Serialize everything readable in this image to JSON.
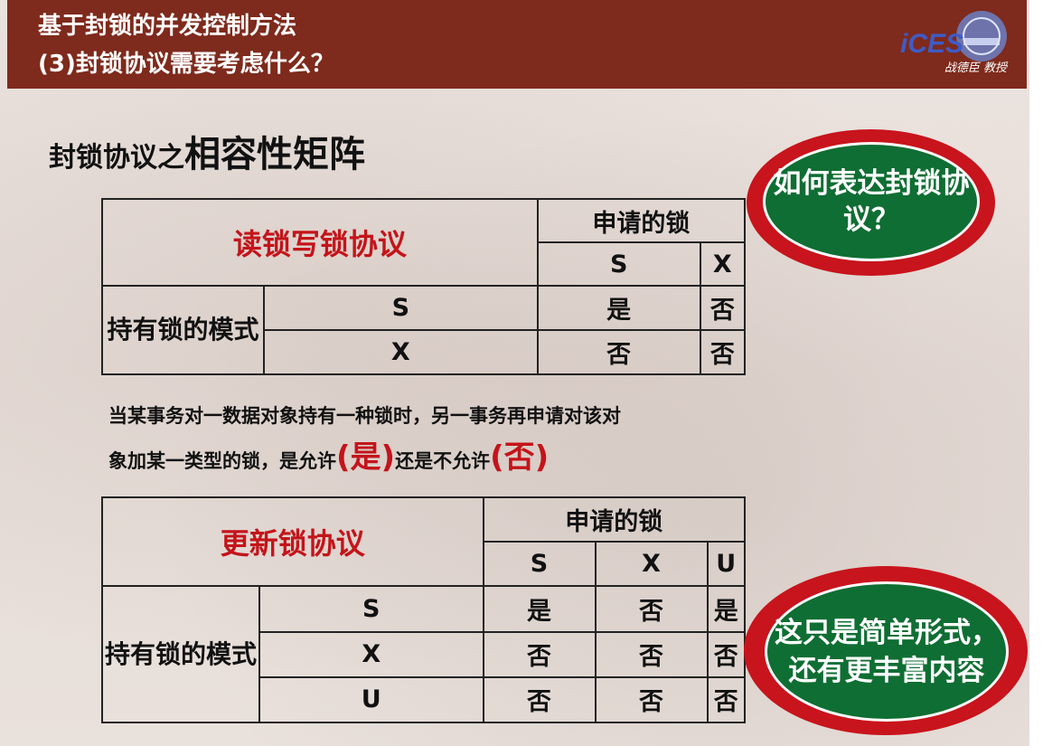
{
  "header": {
    "line1": "基于封锁的并发控制方法",
    "line2": "(3)封锁协议需要考虑什么？",
    "logo_text": "iCES",
    "logo_caption": "战德臣 教授"
  },
  "heading": {
    "part1": "封锁协议之",
    "part2": "相容性矩阵"
  },
  "table1": {
    "title": "读锁写锁协议",
    "requested_label": "申请的锁",
    "columns": [
      "S",
      "X"
    ],
    "held_label": "持有锁的模式",
    "rows": [
      {
        "mode": "S",
        "values": [
          "是",
          "否"
        ]
      },
      {
        "mode": "X",
        "values": [
          "否",
          "否"
        ]
      }
    ]
  },
  "statement": {
    "line1": "当某事务对一数据对象持有一种锁时，另一事务再申请对该对",
    "line2_a": "象加某一类型的锁，是允许",
    "yes": "(是)",
    "line2_b": "还是不允许",
    "no": "(否)"
  },
  "table2": {
    "title": "更新锁协议",
    "requested_label": "申请的锁",
    "columns": [
      "S",
      "X",
      "U"
    ],
    "held_label": "持有锁的模式",
    "rows": [
      {
        "mode": "S",
        "values": [
          "是",
          "否",
          "是"
        ]
      },
      {
        "mode": "X",
        "values": [
          "否",
          "否",
          "否"
        ]
      },
      {
        "mode": "U",
        "values": [
          "否",
          "否",
          "否"
        ]
      }
    ]
  },
  "bubbles": {
    "question": "如何表达封锁协议？",
    "note": "这只是简单形式，还有更丰富内容"
  },
  "colors": {
    "header_bg": "#7e2a1c",
    "accent_red": "#c4141a",
    "bubble_green": "#0f6e33",
    "bubble_ring": "#c8141c"
  }
}
